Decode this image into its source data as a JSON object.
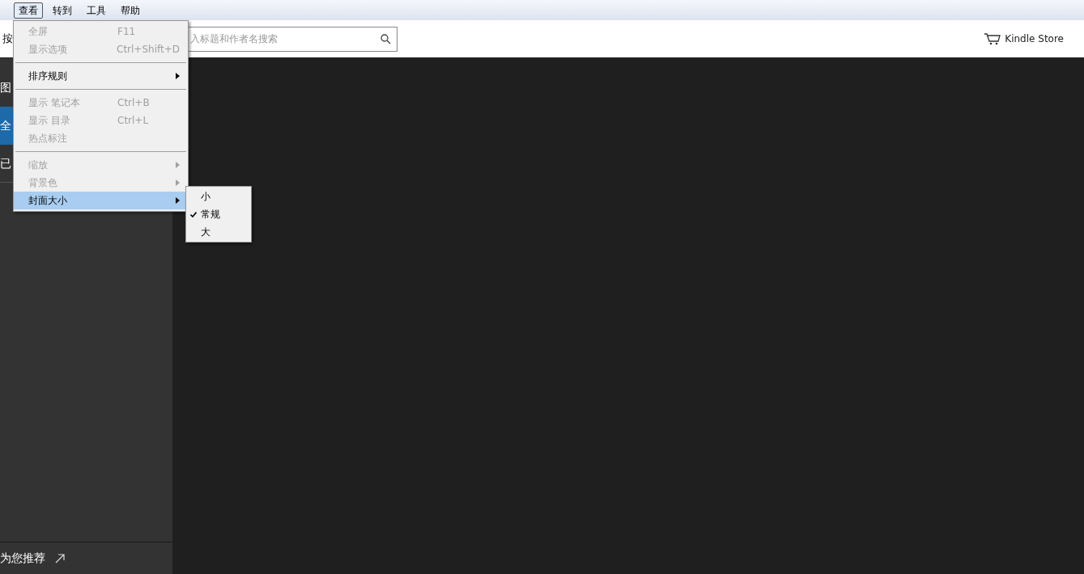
{
  "menubar": [
    {
      "label": "查看",
      "selected": true
    },
    {
      "label": "转到",
      "selected": false
    },
    {
      "label": "工具",
      "selected": false
    },
    {
      "label": "帮助",
      "selected": false
    }
  ],
  "toolbar": {
    "left_label": "按",
    "search": {
      "placeholder": "入标题和作者名搜索"
    },
    "store_link": "Kindle Store"
  },
  "sidebar": {
    "items": [
      {
        "label": "图",
        "selected": false
      },
      {
        "label": "全",
        "selected": true
      },
      {
        "label": "已",
        "selected": false
      }
    ],
    "footer_link": "为您推荐"
  },
  "view_menu": [
    {
      "kind": "item",
      "label": "全屏",
      "shortcut": "F11",
      "disabled": true,
      "submenu": false,
      "selected": false
    },
    {
      "kind": "item",
      "label": "显示选项",
      "shortcut": "Ctrl+Shift+D",
      "disabled": true,
      "submenu": false,
      "selected": false
    },
    {
      "kind": "separator"
    },
    {
      "kind": "item",
      "label": "排序规则",
      "disabled": false,
      "submenu": true,
      "selected": false
    },
    {
      "kind": "separator"
    },
    {
      "kind": "item",
      "label": "显示 笔记本",
      "shortcut": "Ctrl+B",
      "disabled": true,
      "submenu": false,
      "selected": false
    },
    {
      "kind": "item",
      "label": "显示 目录",
      "shortcut": "Ctrl+L",
      "disabled": true,
      "submenu": false,
      "selected": false
    },
    {
      "kind": "item",
      "label": "热点标注",
      "disabled": true,
      "submenu": false,
      "selected": false
    },
    {
      "kind": "separator"
    },
    {
      "kind": "item",
      "label": "缩放",
      "disabled": true,
      "submenu": true,
      "selected": false
    },
    {
      "kind": "item",
      "label": "背景色",
      "disabled": true,
      "submenu": true,
      "selected": false
    },
    {
      "kind": "item",
      "label": "封面大小",
      "disabled": false,
      "submenu": true,
      "selected": true
    }
  ],
  "cover_size_menu": [
    {
      "label": "小",
      "checked": false
    },
    {
      "label": "常规",
      "checked": true
    },
    {
      "label": "大",
      "checked": false
    }
  ]
}
